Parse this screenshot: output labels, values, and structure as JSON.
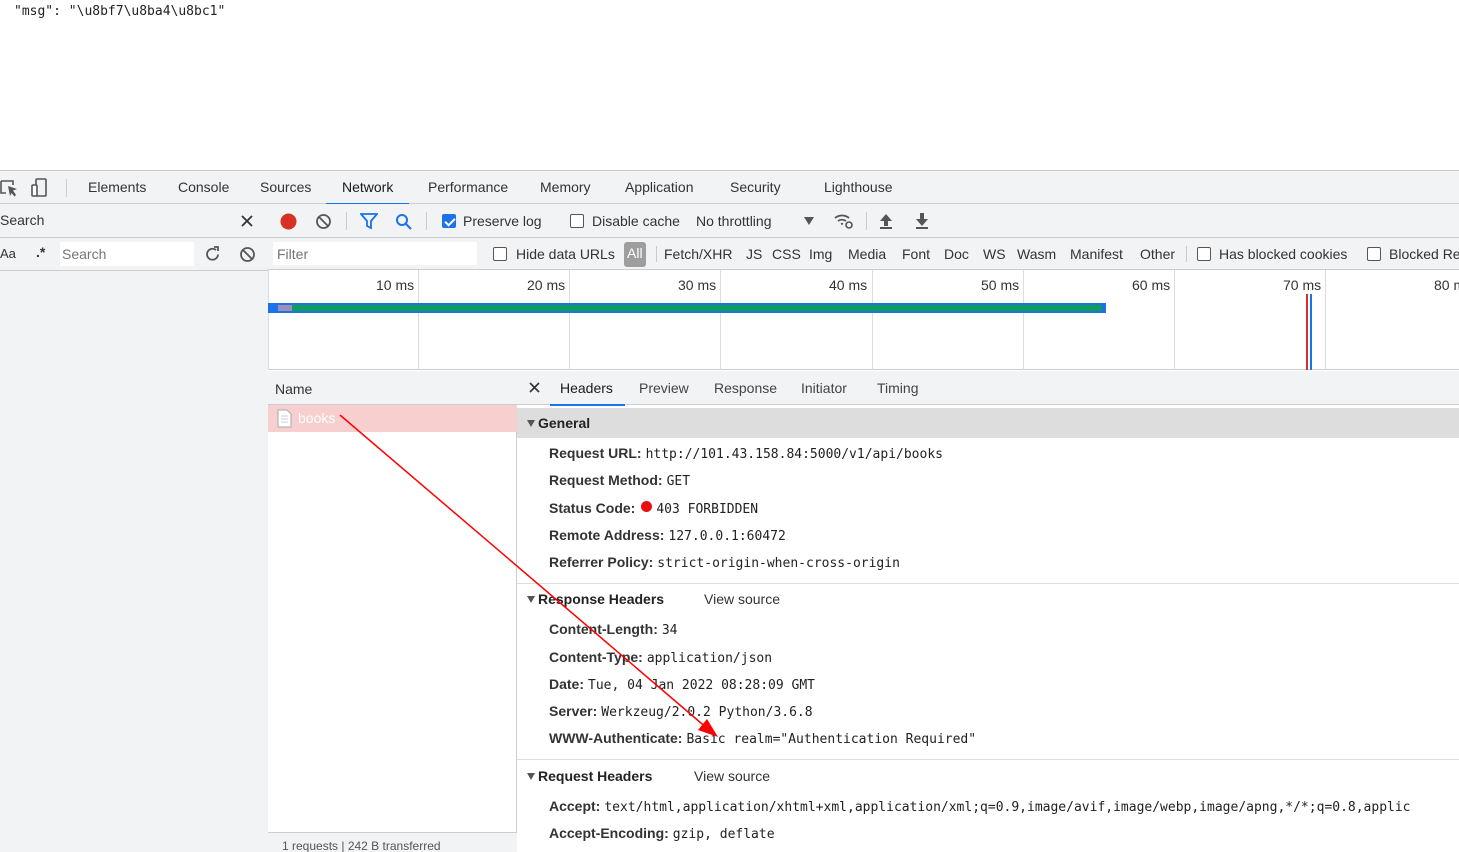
{
  "page": {
    "json_line": "\"msg\": \"\\u8bf7\\u8ba4\\u8bc1\""
  },
  "devtools": {
    "tabs": [
      "Elements",
      "Console",
      "Sources",
      "Network",
      "Performance",
      "Memory",
      "Application",
      "Security",
      "Lighthouse"
    ],
    "active_tab": "Network"
  },
  "search_drawer": {
    "title": "Search",
    "case_label": "Aa",
    "regex_label": ".*",
    "placeholder": "Search"
  },
  "network_toolbar": {
    "preserve_log": "Preserve log",
    "disable_cache": "Disable cache",
    "throttling": "No throttling"
  },
  "filter_bar": {
    "placeholder": "Filter",
    "hide_data_urls": "Hide data URLs",
    "types": [
      "All",
      "Fetch/XHR",
      "JS",
      "CSS",
      "Img",
      "Media",
      "Font",
      "Doc",
      "WS",
      "Wasm",
      "Manifest",
      "Other"
    ],
    "has_blocked_cookies": "Has blocked cookies",
    "blocked_requests": "Blocked Re"
  },
  "overview": {
    "ticks": [
      "10 ms",
      "20 ms",
      "30 ms",
      "40 ms",
      "50 ms",
      "60 ms",
      "70 ms",
      "80 ms"
    ]
  },
  "request_list": {
    "column": "Name",
    "rows": [
      {
        "name": "books"
      }
    ],
    "footer": "1 requests | 242 B transferred"
  },
  "details": {
    "tabs": [
      "Headers",
      "Preview",
      "Response",
      "Initiator",
      "Timing"
    ],
    "general": {
      "title": "General",
      "request_url": {
        "k": "Request URL:",
        "v": "http://101.43.158.84:5000/v1/api/books"
      },
      "request_method": {
        "k": "Request Method:",
        "v": "GET"
      },
      "status_code": {
        "k": "Status Code:",
        "v": "403 FORBIDDEN"
      },
      "remote_address": {
        "k": "Remote Address:",
        "v": "127.0.0.1:60472"
      },
      "referrer_policy": {
        "k": "Referrer Policy:",
        "v": "strict-origin-when-cross-origin"
      }
    },
    "response_headers": {
      "title": "Response Headers",
      "view_source": "View source",
      "content_length": {
        "k": "Content-Length:",
        "v": "34"
      },
      "content_type": {
        "k": "Content-Type:",
        "v": "application/json"
      },
      "date": {
        "k": "Date:",
        "v": "Tue, 04 Jan 2022 08:28:09 GMT"
      },
      "server": {
        "k": "Server:",
        "v": "Werkzeug/2.0.2 Python/3.6.8"
      },
      "www_authenticate": {
        "k": "WWW-Authenticate:",
        "v": "Basic realm=\"Authentication Required\""
      }
    },
    "request_headers": {
      "title": "Request Headers",
      "view_source": "View source",
      "accept": {
        "k": "Accept:",
        "v": "text/html,application/xhtml+xml,application/xml;q=0.9,image/avif,image/webp,image/apng,*/*;q=0.8,applic"
      },
      "accept_encoding": {
        "k": "Accept-Encoding:",
        "v": "gzip, deflate"
      }
    }
  },
  "colors": {
    "accent": "#1a73e8",
    "error_row": "#f8cfcf",
    "record": "#d93025",
    "waterfall_green": "#0f9d58",
    "waterfall_blue": "#1a73e8",
    "arrow": "#ff0000"
  }
}
